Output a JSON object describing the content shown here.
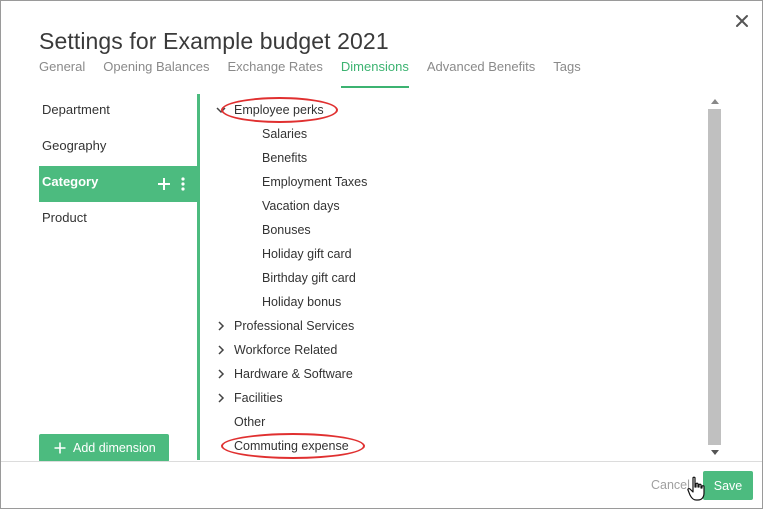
{
  "dialog": {
    "title": "Settings for Example budget 2021",
    "close_icon": "close-icon"
  },
  "tabs": [
    {
      "label": "General",
      "active": false
    },
    {
      "label": "Opening Balances",
      "active": false
    },
    {
      "label": "Exchange Rates",
      "active": false
    },
    {
      "label": "Dimensions",
      "active": true
    },
    {
      "label": "Advanced Benefits",
      "active": false
    },
    {
      "label": "Tags",
      "active": false
    }
  ],
  "dimensions": [
    {
      "label": "Department",
      "active": false
    },
    {
      "label": "Geography",
      "active": false
    },
    {
      "label": "Category",
      "active": true
    },
    {
      "label": "Product",
      "active": false
    }
  ],
  "add_dimension_label": "Add dimension",
  "tree": {
    "expanded_group": "Employee perks",
    "children": [
      "Salaries",
      "Benefits",
      "Employment Taxes",
      "Vacation days",
      "Bonuses",
      "Holiday gift card",
      "Birthday gift card",
      "Holiday bonus"
    ],
    "collapsed_groups": [
      "Professional Services",
      "Workforce Related",
      "Hardware & Software",
      "Facilities"
    ],
    "leaves": [
      "Other",
      "Commuting expense"
    ]
  },
  "footer": {
    "cancel_label": "Cancel",
    "save_label": "Save"
  },
  "colors": {
    "accent": "#4cbb7f",
    "highlight_circle": "#e03030"
  }
}
